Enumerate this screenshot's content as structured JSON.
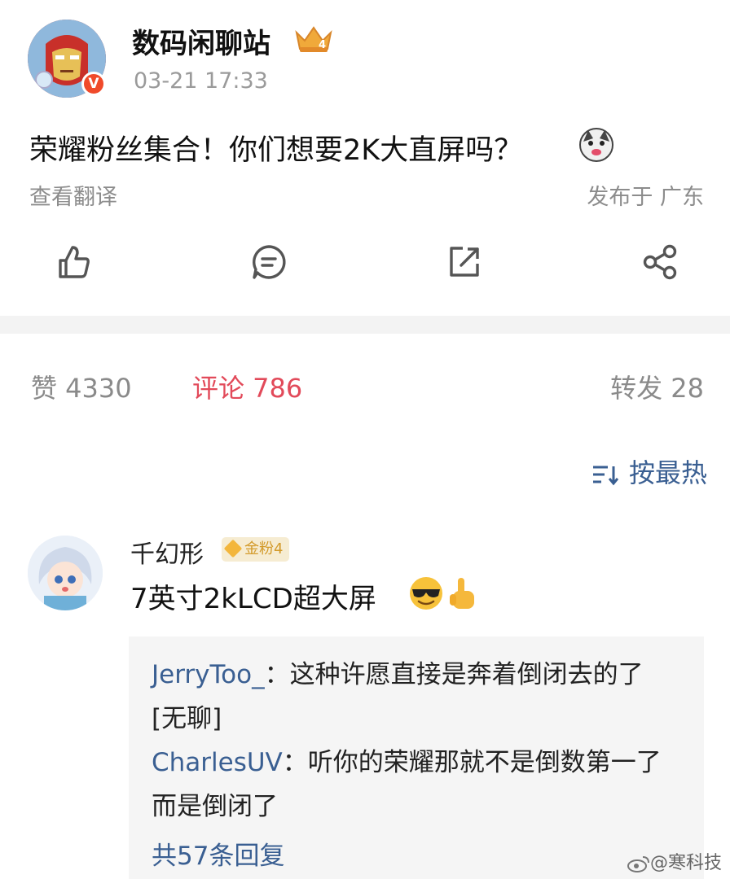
{
  "post": {
    "username": "数码闲聊站",
    "level_badge": "4",
    "verified_badge": "V",
    "timestamp": "03-21 17:33",
    "text": "荣耀粉丝集合！你们想要2K大直屏吗？",
    "translate_link": "查看翻译",
    "location": "发布于 广东"
  },
  "actions": {
    "like_icon": "thumbs-up-icon",
    "comment_icon": "comment-icon",
    "repost_icon": "share-out-icon",
    "share_icon": "share-nodes-icon"
  },
  "stats": {
    "likes": "赞 4330",
    "comments": "评论 786",
    "reposts": "转发 28"
  },
  "sort": {
    "label": "按最热"
  },
  "comment": {
    "username": "千幻形",
    "fan_badge": "金粉4",
    "text": "7英寸2kLCD超大屏",
    "replies": [
      {
        "name": "JerryToo_",
        "sep": "：",
        "text": "这种许愿直接是奔着倒闭去的了[无聊]"
      },
      {
        "name": "CharlesUV",
        "sep": "：",
        "text": "听你的荣耀那就不是倒数第一了而是倒闭了"
      }
    ],
    "more_replies": "共57条回复"
  },
  "watermark": "@寒科技",
  "colors": {
    "accent_red": "#e24a5a",
    "link_blue": "#3a5f92",
    "muted_gray": "#8a8a8a"
  }
}
